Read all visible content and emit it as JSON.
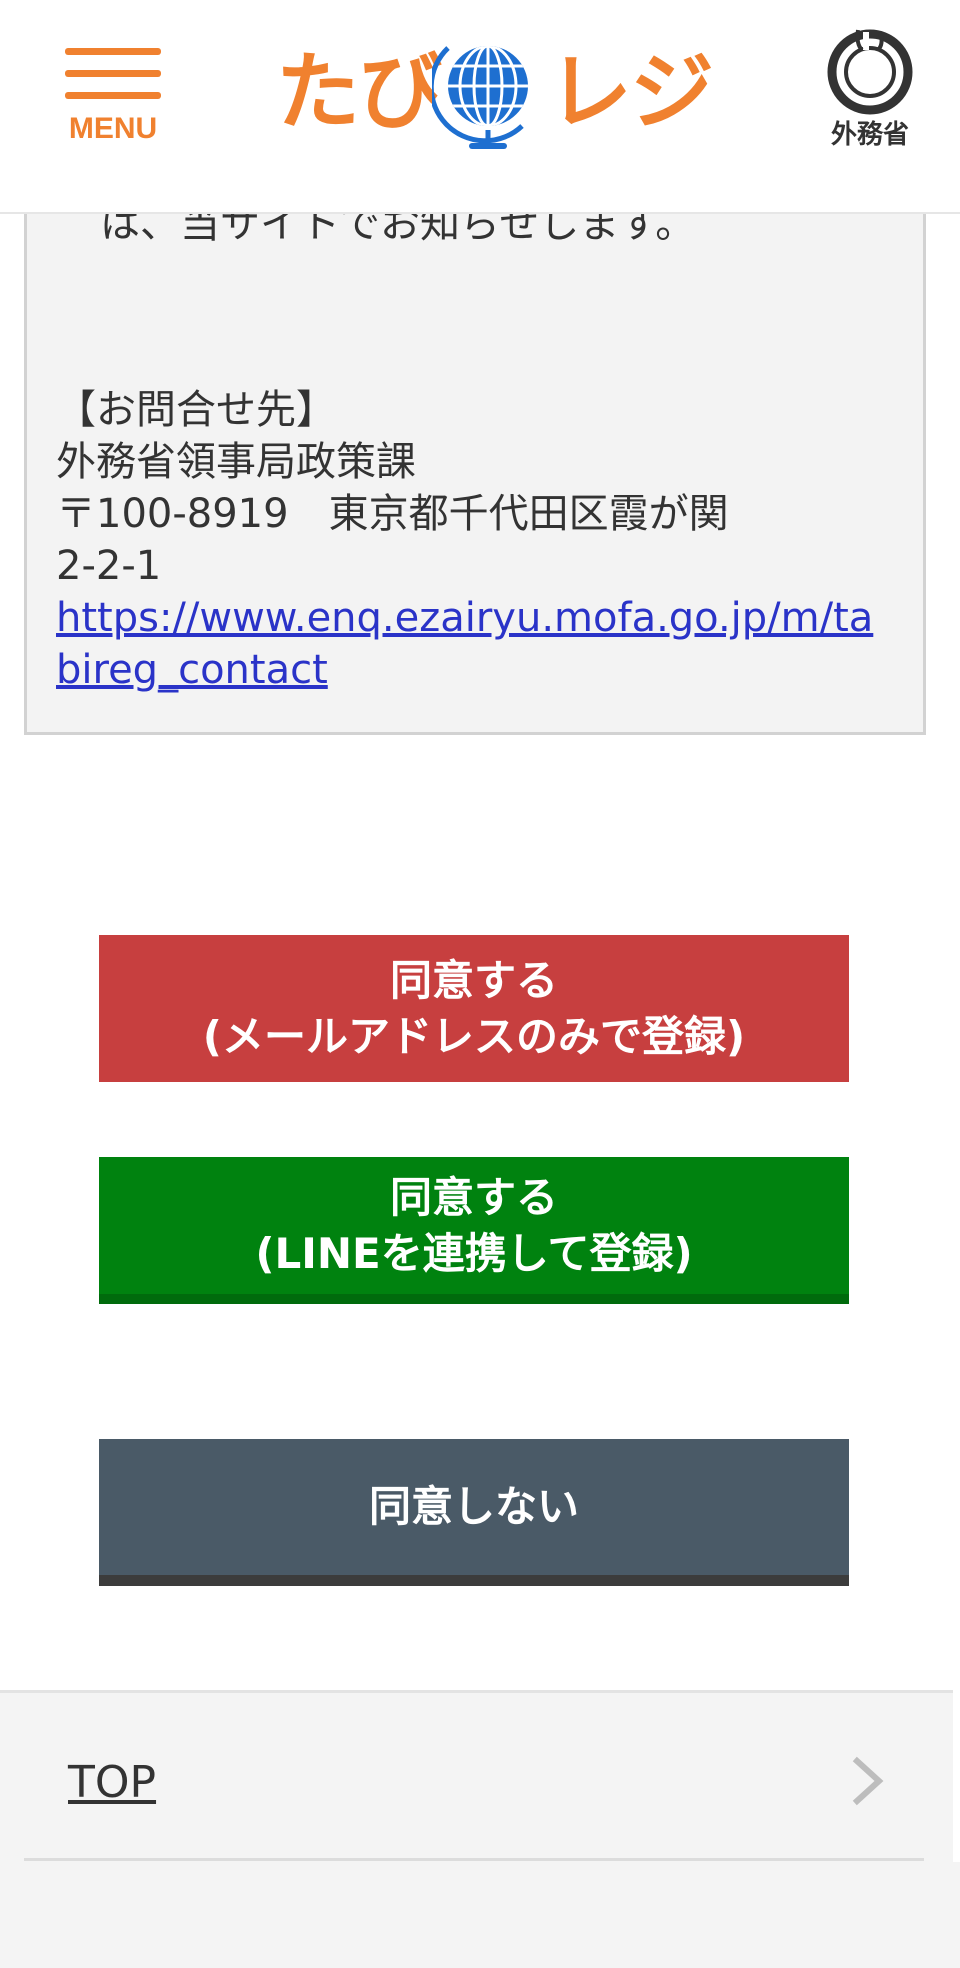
{
  "header": {
    "menu_label": "MENU",
    "logo_left": "たび",
    "logo_right": "レジ",
    "ministry_label": "外務省"
  },
  "content": {
    "cut_line": "は、当サイトでお知らせします。",
    "contact_heading": "【お問合せ先】",
    "contact_org": "外務省領事局政策課",
    "contact_address": "〒100-8919　東京都千代田区霞が関",
    "contact_address2": "2-2-1",
    "contact_url": "https://www.enq.ezairyu.mofa.go.jp/m/tabireg_contact"
  },
  "buttons": {
    "agree_email_line1": "同意する",
    "agree_email_line2": "(メールアドレスのみで登録)",
    "agree_line_line1": "同意する",
    "agree_line_line2": "(LINEを連携して登録)",
    "decline": "同意しない"
  },
  "footer": {
    "top_link": "TOP"
  },
  "colors": {
    "brand_orange": "#f0812f",
    "agree_email_bg": "#c73f3f",
    "agree_line_bg": "#00820f",
    "decline_bg": "#4a5a67",
    "link_blue": "#2a33c8"
  },
  "icons": {
    "menu": "hamburger-icon",
    "logo_globe": "globe-icon",
    "ministry_emblem": "mofa-emblem-icon",
    "footer_arrow": "chevron-right-icon"
  }
}
